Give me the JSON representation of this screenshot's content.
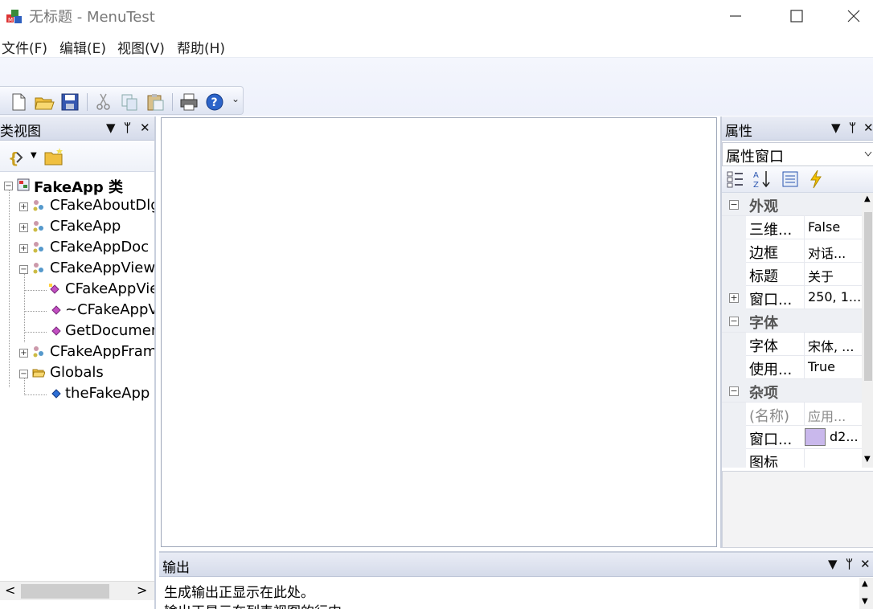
{
  "window": {
    "title": "无标题 - MenuTest",
    "minimize": "—",
    "maximize": "☐",
    "close": "✕"
  },
  "menu": {
    "items": [
      {
        "label": "文件(F)"
      },
      {
        "label": "编辑(E)"
      },
      {
        "label": "视图(V)"
      },
      {
        "label": "帮助(H)"
      }
    ]
  },
  "toolbar": {
    "buttons": [
      "new-icon",
      "open-icon",
      "save-icon",
      "cut-icon",
      "copy-icon",
      "paste-icon",
      "print-icon",
      "help-icon"
    ],
    "overflow": "⌄"
  },
  "class_view": {
    "title": "类视图",
    "dropdown": "▼",
    "pin": "ᛘ",
    "close": "✕",
    "tree": [
      {
        "label": "FakeApp 类",
        "bold": true
      },
      {
        "label": "CFakeAboutDlg"
      },
      {
        "label": "CFakeApp"
      },
      {
        "label": "CFakeAppDoc"
      },
      {
        "label": "CFakeAppView"
      },
      {
        "label": "CFakeAppView"
      },
      {
        "label": "~CFakeAppView"
      },
      {
        "label": "GetDocument"
      },
      {
        "label": "CFakeAppFrame"
      },
      {
        "label": "Globals"
      },
      {
        "label": "theFakeApp"
      }
    ],
    "scroll_left": "<",
    "scroll_right": ">"
  },
  "output": {
    "title": "输出",
    "dropdown": "▼",
    "pin": "ᛘ",
    "close": "✕",
    "lines": [
      "生成输出正显示在此处。",
      "输出正显示在列表视图的行中"
    ]
  },
  "properties": {
    "title": "属性",
    "dropdown": "▼",
    "pin": "ᛘ",
    "close": "✕",
    "combo_value": "属性窗口",
    "categories": [
      {
        "label": "外观",
        "rows": [
          {
            "name": "三维...",
            "value": "False"
          },
          {
            "name": "边框",
            "value": "对话..."
          },
          {
            "name": "标题",
            "value": "关于"
          },
          {
            "name": "窗口...",
            "value": "250, 1...",
            "expandable": true
          }
        ]
      },
      {
        "label": "字体",
        "rows": [
          {
            "name": "字体",
            "value": "宋体, ..."
          },
          {
            "name": "使用...",
            "value": "True"
          }
        ]
      },
      {
        "label": "杂项",
        "rows": [
          {
            "name": "(名称)",
            "value": "应用..."
          },
          {
            "name": "窗口...",
            "value": "d2..."
          },
          {
            "name": "图标",
            "value": ""
          }
        ]
      }
    ],
    "swatch_color": "#c9b8ec"
  }
}
